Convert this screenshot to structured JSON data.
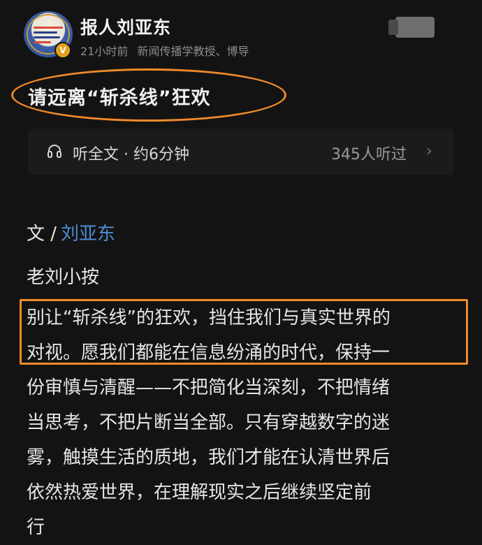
{
  "header": {
    "author_name": "报人刘亚东",
    "time_ago": "21小时前",
    "author_title": "新闻传播学教授、博导",
    "verified_badge": "V"
  },
  "article": {
    "title": "请远离“斩杀线”狂欢",
    "listen_label": "听全文 · 约6分钟",
    "listen_count": "345人听过",
    "byline_prefix": "文 /",
    "byline_author": "刘亚东",
    "subhead": "老刘小按",
    "paragraph_lines": [
      "别让“斩杀线”的狂欢，挡住我们与真实世界的",
      "对视。愿我们都能在信息纷涌的时代，保持一",
      "份审慎与清醒——不把简化当深刻，不把情绪",
      "当思考，不把片断当全部。只有穿越数字的迷",
      "雾，触摸生活的质地，我们才能在认清世界后",
      "依然热爱世界，在理解现实之后继续坚定前",
      "行"
    ]
  },
  "colors": {
    "background": "#131313",
    "highlight": "#f08a2a",
    "link": "#4f8fd6"
  },
  "icons": {
    "listen": "headphone-icon",
    "more": "chevron-right-icon"
  }
}
